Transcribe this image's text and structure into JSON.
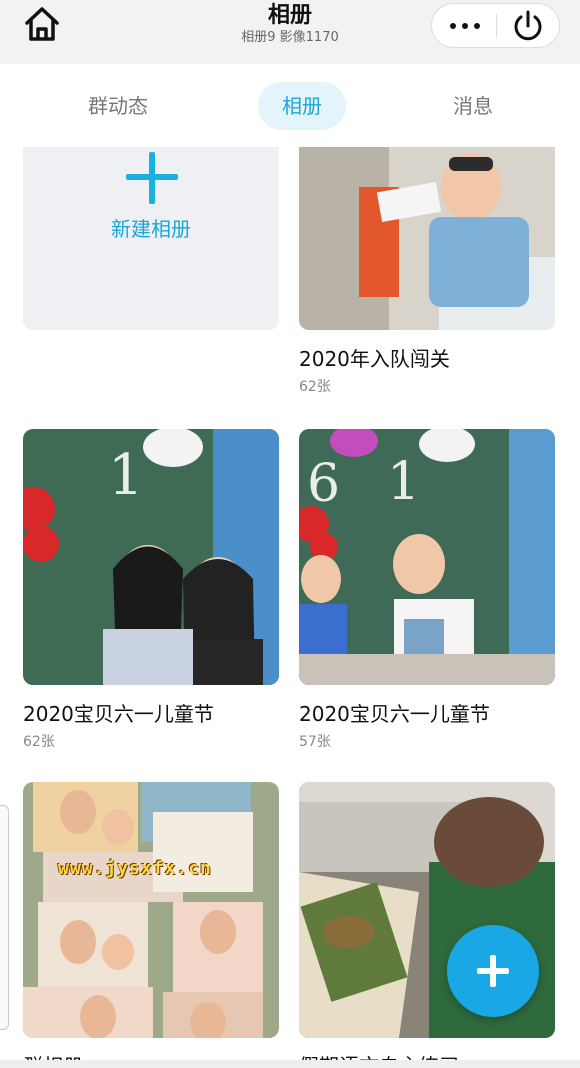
{
  "header": {
    "title": "相册",
    "subtitle": "相册9 影像1170"
  },
  "tabs": [
    {
      "label": "群动态",
      "active": false
    },
    {
      "label": "相册",
      "active": true
    },
    {
      "label": "消息",
      "active": false
    }
  ],
  "new_album": {
    "label": "新建相册"
  },
  "albums": [
    {
      "name": "2020年入队闯关",
      "count": "62张"
    },
    {
      "name": "2020宝贝六一儿童节",
      "count": "62张"
    },
    {
      "name": "2020宝贝六一儿童节",
      "count": "57张"
    },
    {
      "name": "群相册",
      "count": ""
    },
    {
      "name": "假期语文自主练习",
      "count": ""
    }
  ],
  "watermark": "www.jysxfx.cn",
  "colors": {
    "accent": "#1aa7d8",
    "tab_active_bg": "#e3f4fa",
    "fab": "#1aa7e6"
  },
  "icons": {
    "home": "home-icon",
    "more": "more-dots-icon",
    "power": "power-icon",
    "add": "plus-icon"
  }
}
